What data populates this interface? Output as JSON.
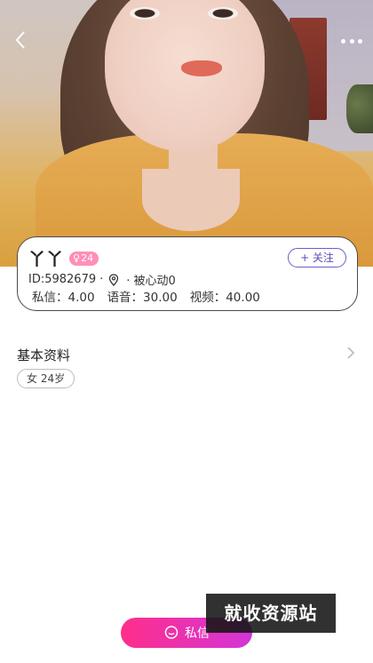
{
  "header": {
    "back_icon": "chevron-left-icon",
    "more_icon": "more-dots-icon"
  },
  "profile": {
    "name": "丫丫",
    "age_badge": "24",
    "follow_label": "+ 关注",
    "id_text": "ID:5982679",
    "location_icon": "location-pin-icon",
    "liked_text": "· 被心动0",
    "prices": [
      {
        "label": "私信：4.00"
      },
      {
        "label": "语音：30.00"
      },
      {
        "label": "视频：40.00"
      }
    ]
  },
  "basic_info": {
    "title": "基本资料",
    "tag": "女 24岁"
  },
  "bottom": {
    "message_label": "私信",
    "watermark": "就收资源站"
  },
  "colors": {
    "accent_pink": "#ff2e8a",
    "accent_purple": "#d335d8",
    "follow_purple": "#5a4fb5",
    "badge_pink": "#ff8fb8"
  }
}
